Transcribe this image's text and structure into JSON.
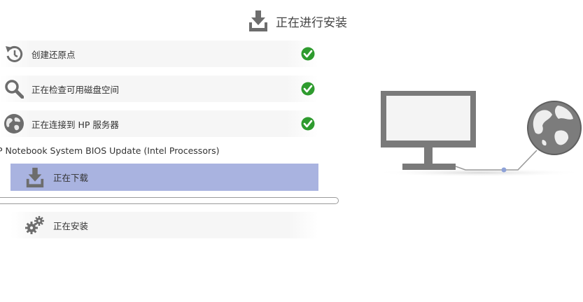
{
  "header": {
    "title": "正在进行安装",
    "icon": "download-icon"
  },
  "steps": [
    {
      "label": "创建还原点",
      "icon": "restore-icon",
      "status": "done"
    },
    {
      "label": "正在检查可用磁盘空间",
      "icon": "magnifier-icon",
      "status": "done"
    },
    {
      "label": "正在连接到 HP 服务器",
      "icon": "globe-icon",
      "status": "done"
    }
  ],
  "product_name": "P Notebook System BIOS Update (Intel Processors)",
  "downloading": {
    "label": "正在下载",
    "icon": "download-icon",
    "highlight_color": "#a9b3e0"
  },
  "installing": {
    "label": "正在安装",
    "icon": "gears-icon"
  },
  "colors": {
    "check": "#2e9b2e",
    "icon_gray": "#6d6d6d",
    "monitor": "#7a7a7a"
  }
}
